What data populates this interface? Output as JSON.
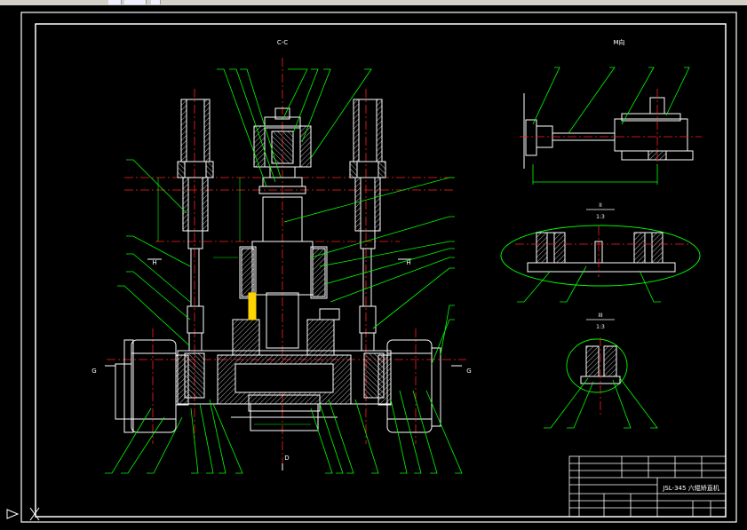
{
  "views": {
    "main_section": "C-C",
    "side_view": "M向",
    "detail_2_title": "II",
    "detail_2_scale": "1:3",
    "detail_3_title": "III",
    "detail_3_scale": "1:3"
  },
  "section_markers": {
    "h_left": "H",
    "h_right": "H",
    "g_left": "G",
    "g_right": "G",
    "d_bottom": "D"
  },
  "title_block": {
    "drawing_title": "JSL-345 六辊矫直机"
  },
  "colors": {
    "background": "#000000",
    "outline": "#ffffff",
    "centerline": "#ff2020",
    "leader": "#00ff00",
    "hatch": "#ffffff",
    "part_yellow": "#ffd400"
  }
}
